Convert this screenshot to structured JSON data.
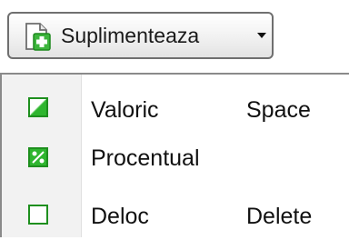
{
  "toolbar": {
    "button_label": "Suplimenteaza",
    "button_icon": "document-add-icon"
  },
  "menu": {
    "items": [
      {
        "label": "Valoric",
        "shortcut": "Space",
        "icon": "half-filled-square-icon"
      },
      {
        "label": "Procentual",
        "shortcut": "",
        "icon": "percent-square-icon"
      },
      {
        "label": "Deloc",
        "shortcut": "Delete",
        "icon": "empty-square-icon"
      }
    ]
  },
  "colors": {
    "icon_green": "#2fb52f",
    "icon_green_border": "#1e8f1e"
  }
}
